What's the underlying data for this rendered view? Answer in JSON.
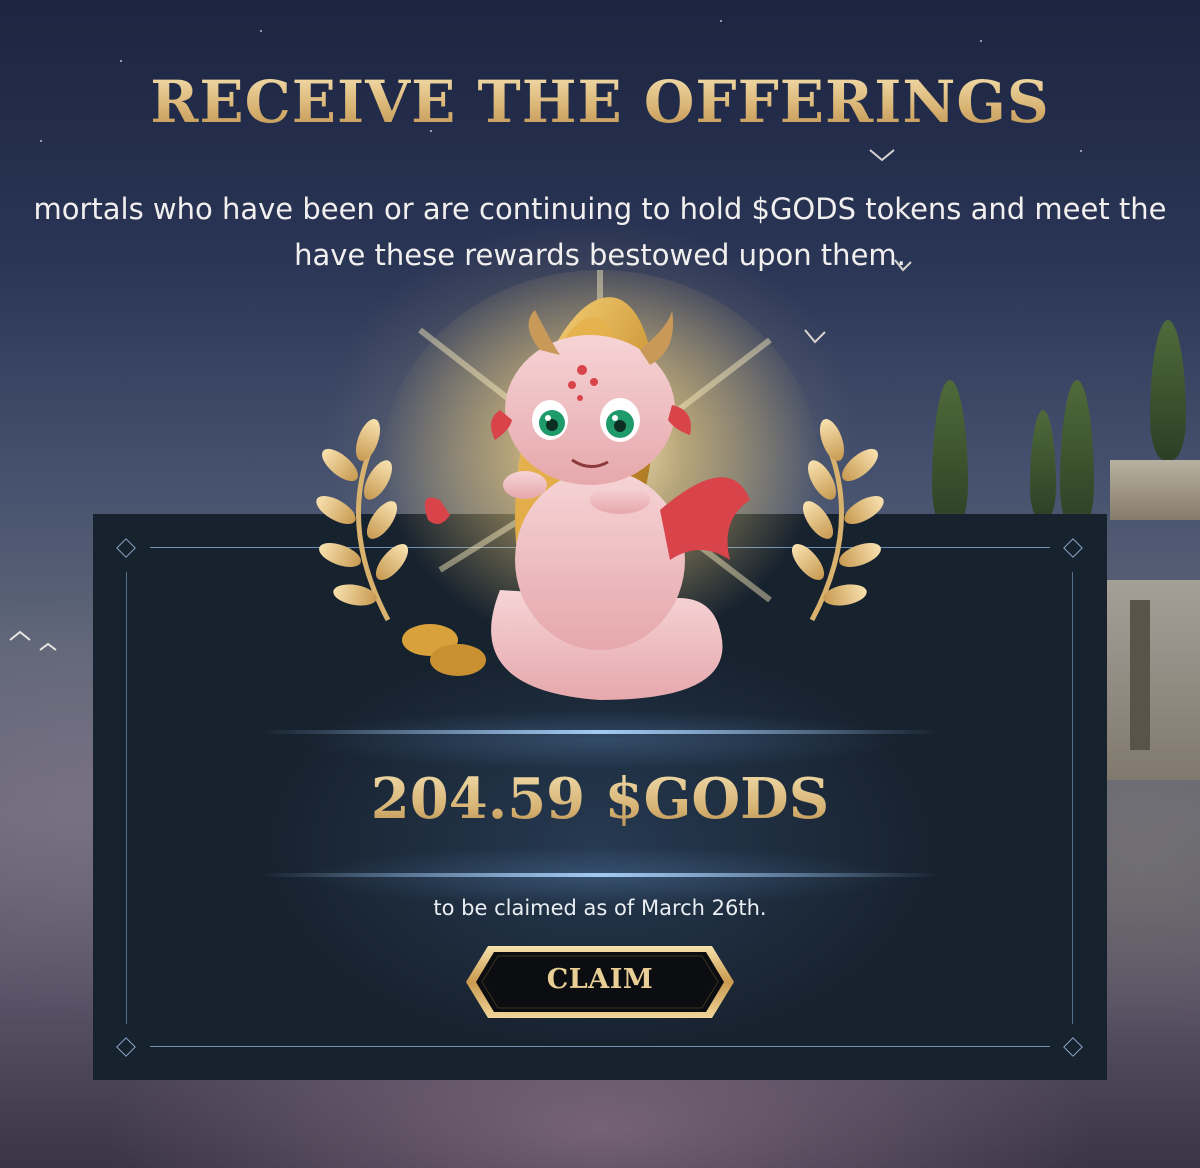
{
  "header": {
    "title": "RECEIVE THE OFFERINGS",
    "subtitle_line1": "mortals who have been or are continuing to hold $GODS tokens and meet the",
    "subtitle_line2": "have these rewards bestowed upon them."
  },
  "reward_card": {
    "amount": "204.59 $GODS",
    "note": "to be claimed as of March 26th.",
    "claim_label": "CLAIM"
  },
  "colors": {
    "gold": "#e0c38b",
    "panel": "#17222f",
    "frame": "#6f8fb3",
    "glow": "#a8d0f8"
  },
  "icons": {
    "laurel_left": "laurel-branch-icon",
    "laurel_right": "laurel-branch-icon",
    "mascot": "baby-dragon-with-coin",
    "corner": "diamond-icon"
  }
}
